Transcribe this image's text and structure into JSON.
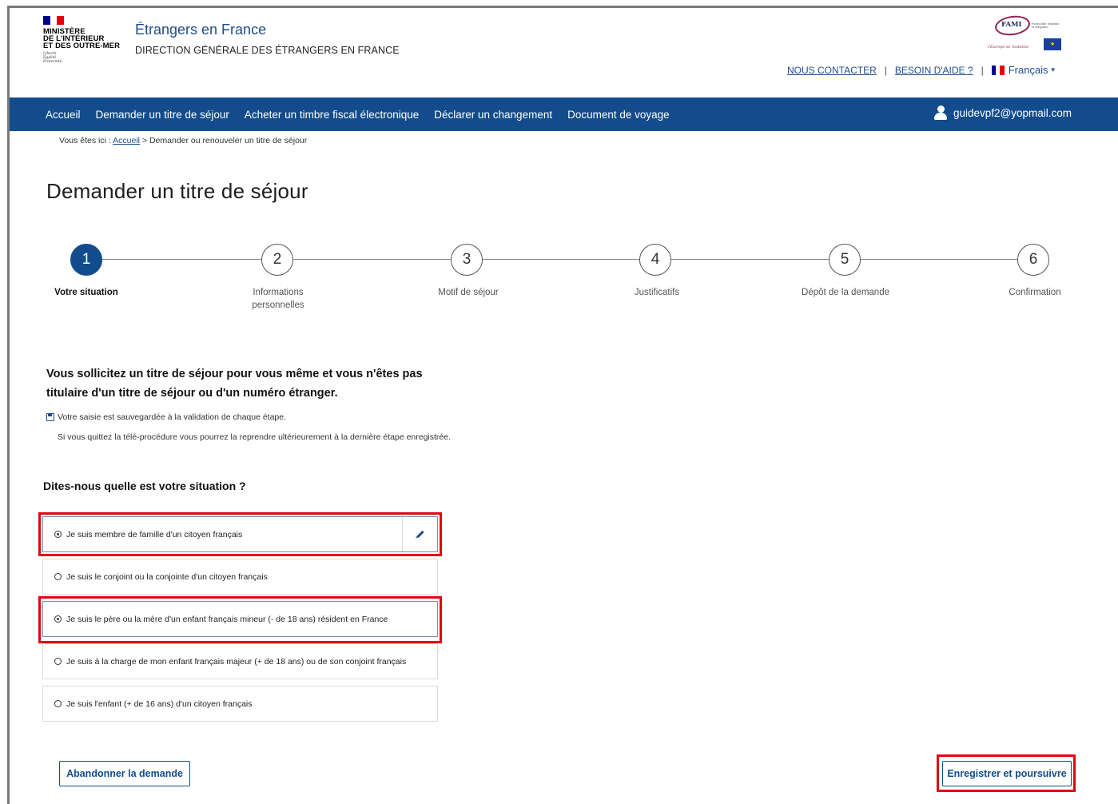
{
  "header": {
    "ministry_lines": [
      "MINISTÈRE",
      "DE L'INTÉRIEUR",
      "ET DES OUTRE-MER"
    ],
    "devise_lines": [
      "Liberté",
      "Égalité",
      "Fraternité"
    ],
    "site_title": "Étrangers en France",
    "site_subtitle": "DIRECTION GÉNÉRALE DES ÉTRANGERS EN FRANCE",
    "fami_logo_text": "FAMI",
    "fami_small_text": "Fonds Asile, Migration et Intégration",
    "fami_motto": "l'Europe se mobilise",
    "contact_link": "NOUS CONTACTER",
    "help_link": "BESOIN D'AIDE ?",
    "separator": "|",
    "language": "Français",
    "language_caret": "▾"
  },
  "nav": {
    "items": [
      "Accueil",
      "Demander un titre de séjour",
      "Acheter un timbre fiscal électronique",
      "Déclarer un changement",
      "Document de voyage"
    ],
    "user_email": "guidevpf2@yopmail.com"
  },
  "breadcrumb": {
    "prefix": "Vous êtes ici :",
    "home": "Accueil",
    "current": "> Demander ou renouveler un titre de séjour"
  },
  "page_title": "Demander un titre de séjour",
  "steps": [
    {
      "number": "1",
      "label": "Votre situation",
      "active": true
    },
    {
      "number": "2",
      "label": "Informations personnelles",
      "active": false
    },
    {
      "number": "3",
      "label": "Motif de séjour",
      "active": false
    },
    {
      "number": "4",
      "label": "Justificatifs",
      "active": false
    },
    {
      "number": "5",
      "label": "Dépôt de la demande",
      "active": false
    },
    {
      "number": "6",
      "label": "Confirmation",
      "active": false
    }
  ],
  "intro": "Vous sollicitez un titre de séjour pour vous même et vous n'êtes pas titulaire d'un titre de séjour ou d'un numéro étranger.",
  "save_note": "Votre saisie est sauvegardée à la validation de chaque étape.",
  "quit_note": "Si vous quittez la télé-procédure vous pourrez la reprendre ultérieurement à la dernière étape enregistrée.",
  "question": "Dites-nous quelle est votre situation ?",
  "options": [
    {
      "label": "Je suis membre de famille d'un citoyen français",
      "checked": true
    },
    {
      "label": "Je suis le conjoint ou la conjointe d'un citoyen français",
      "checked": false
    },
    {
      "label": "Je suis le père ou la mère d'un enfant français mineur (- de 18 ans) résident en France",
      "checked": true
    },
    {
      "label": "Je suis à la charge de mon enfant français majeur (+ de 18 ans) ou de son conjoint français",
      "checked": false
    },
    {
      "label": "Je suis l'enfant (+ de 16 ans) d'un citoyen français",
      "checked": false
    }
  ],
  "buttons": {
    "abandon": "Abandonner la demande",
    "save_continue": "Enregistrer et poursuivre"
  },
  "colors": {
    "primary": "#124c8c",
    "highlight": "#e30613"
  },
  "icons": [
    "user-icon",
    "floppy-icon",
    "pencil-icon",
    "radio-icon",
    "french-flag-icon",
    "eu-flag-icon"
  ]
}
